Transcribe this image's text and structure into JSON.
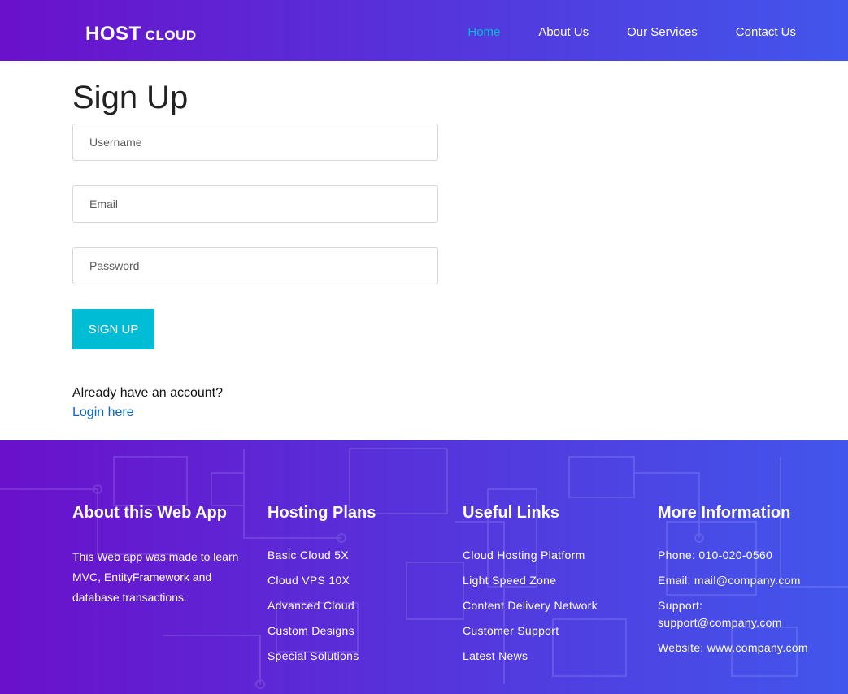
{
  "header": {
    "brand_main": "HOST",
    "brand_sub": "CLOUD",
    "nav": [
      {
        "label": "Home",
        "active": true
      },
      {
        "label": "About Us"
      },
      {
        "label": "Our Services"
      },
      {
        "label": "Contact Us"
      }
    ]
  },
  "signup": {
    "title": "Sign Up",
    "username_placeholder": "Username",
    "email_placeholder": "Email",
    "password_placeholder": "Password",
    "submit_label": "SIGN UP",
    "account_text": "Already have an account?",
    "login_link": "Login here"
  },
  "footer": {
    "about": {
      "title": "About this Web App",
      "text": "This Web app was made to learn MVC, EntityFramework and database transactions."
    },
    "plans": {
      "title": "Hosting Plans",
      "items": [
        "Basic Cloud 5X",
        "Cloud VPS 10X",
        "Advanced Cloud",
        "Custom Designs",
        "Special Solutions"
      ]
    },
    "links": {
      "title": "Useful Links",
      "items": [
        "Cloud Hosting Platform",
        "Light Speed Zone",
        "Content Delivery Network",
        "Customer Support",
        "Latest News"
      ]
    },
    "info": {
      "title": "More Information",
      "items": [
        "Phone: 010-020-0560",
        "Email: mail@company.com",
        "Support: support@company.com",
        "Website: www.company.com"
      ]
    }
  },
  "colors": {
    "gradient_start": "#6a11cb",
    "gradient_end": "#4256ec",
    "accent": "#00bcd4",
    "link": "#0a66c2"
  }
}
